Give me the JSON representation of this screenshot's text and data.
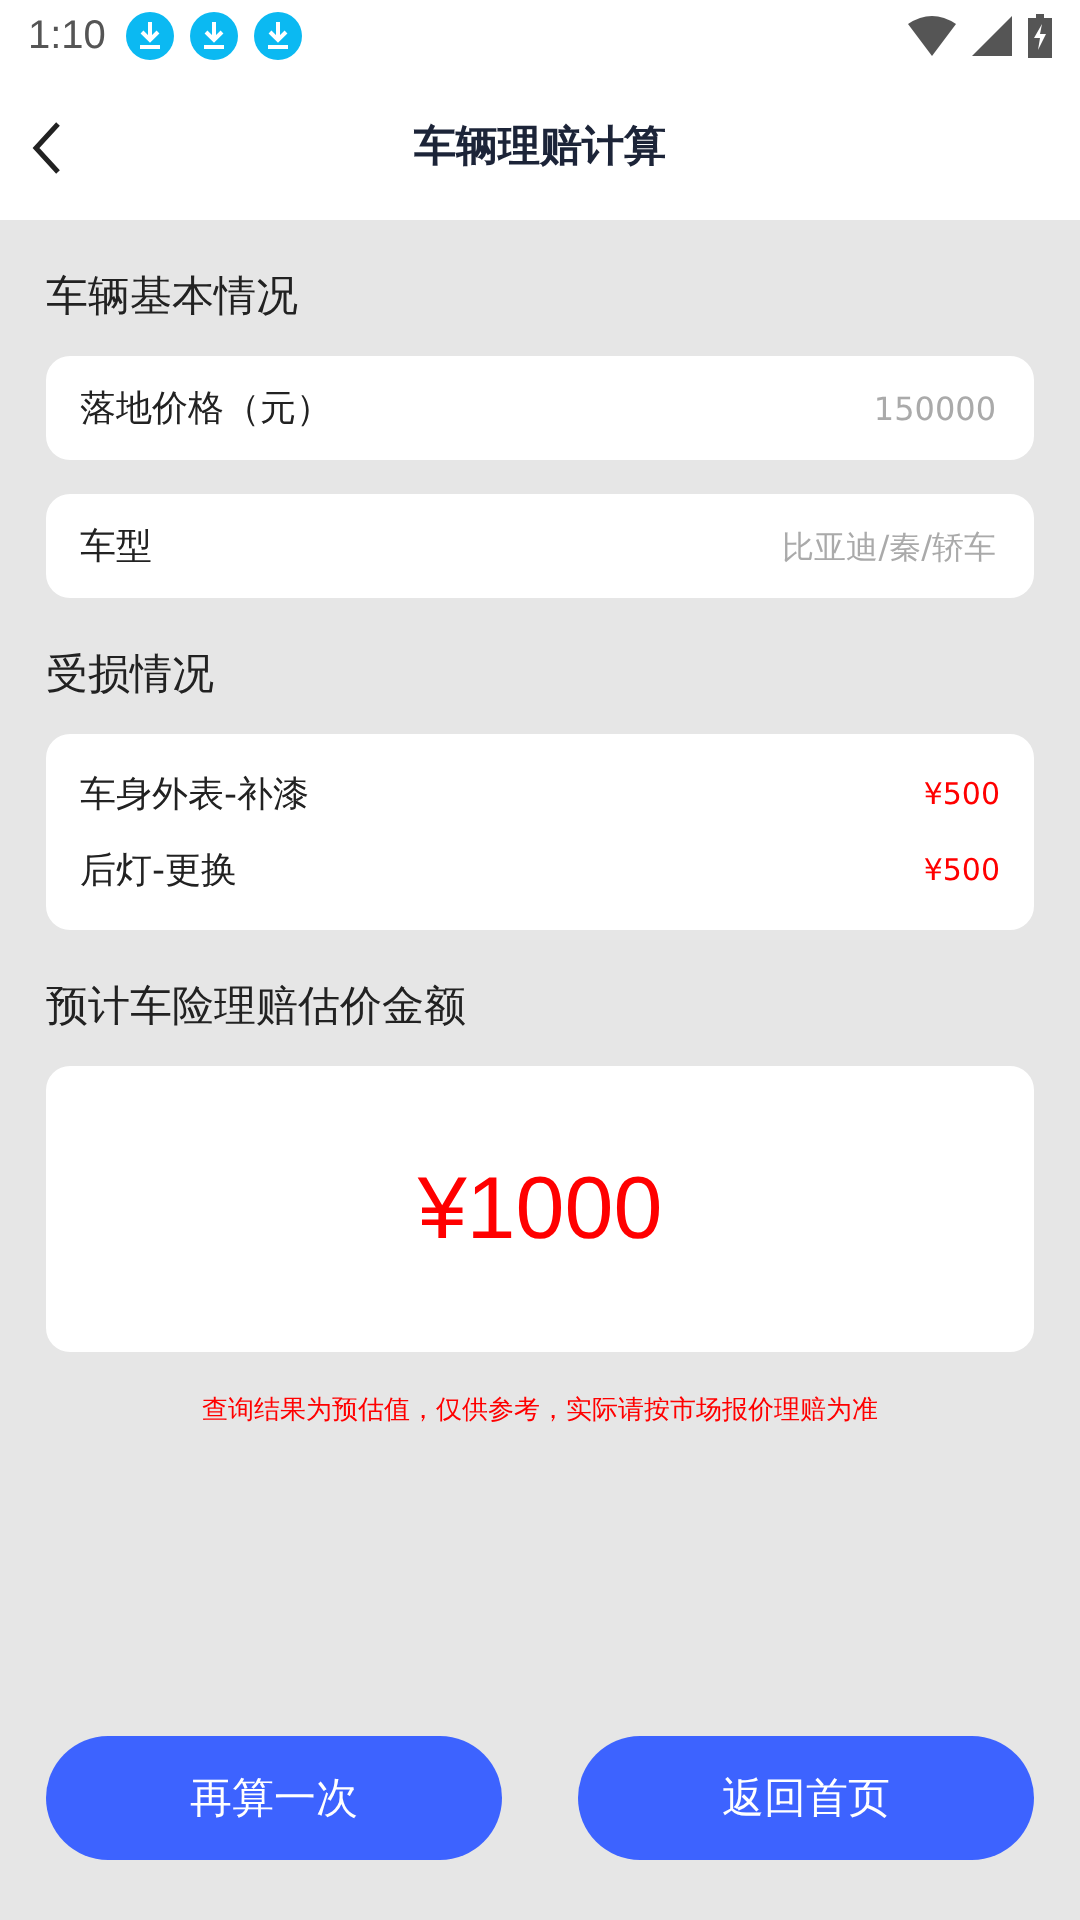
{
  "status_bar": {
    "time": "1:10",
    "notifications": [
      {
        "kind": "download"
      },
      {
        "kind": "download"
      },
      {
        "kind": "download"
      }
    ]
  },
  "header": {
    "title": "车辆理赔计算"
  },
  "basic_info": {
    "title": "车辆基本情况",
    "fields": [
      {
        "label": "落地价格（元）",
        "placeholder": "150000"
      },
      {
        "label": "车型",
        "placeholder": "比亚迪/秦/轿车"
      }
    ]
  },
  "damage": {
    "title": "受损情况",
    "items": [
      {
        "name": "车身外表-补漆",
        "price": "¥500"
      },
      {
        "name": "后灯-更换",
        "price": "¥500"
      }
    ]
  },
  "estimate": {
    "title": "预计车险理赔估价金额",
    "amount": "¥1000",
    "note": "查询结果为预估值，仅供参考，实际请按市场报价理赔为准"
  },
  "buttons": [
    "再算一次",
    "返回首页"
  ]
}
